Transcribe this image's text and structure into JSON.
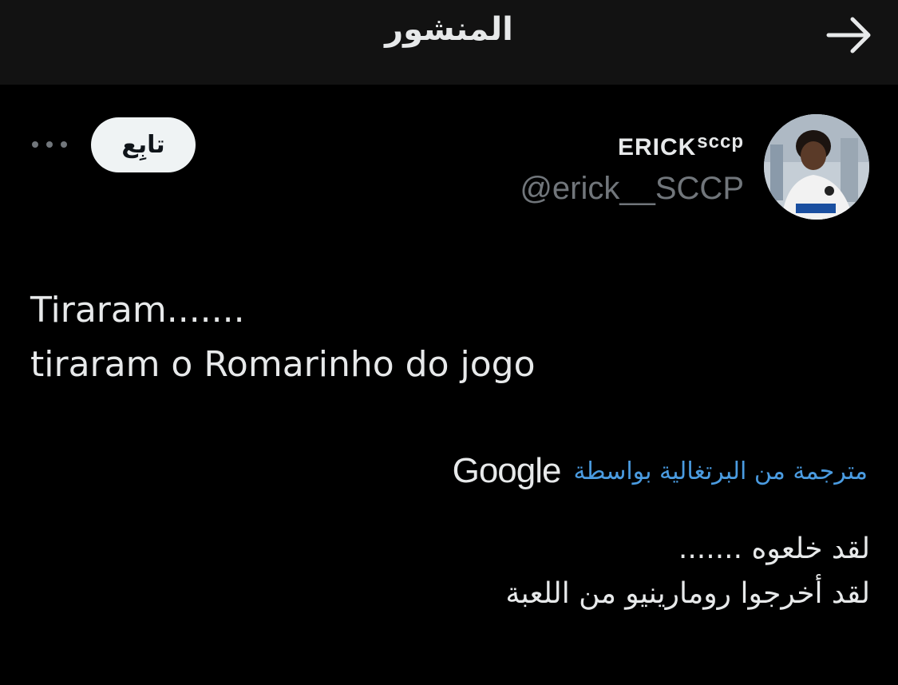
{
  "header": {
    "title": "المنشور",
    "back_icon": "arrow-right-icon"
  },
  "post": {
    "author": {
      "name": "ERICK",
      "name_suffix": "sccp",
      "handle": "@erick__SCCP",
      "avatar": "profile-photo"
    },
    "follow_label": "تابِع",
    "more_icon": "more-horizontal-icon",
    "text": "Tiraram.......\ntiraram o Romarinho do jogo",
    "translation": {
      "label": "مترجمة من البرتغالية بواسطة",
      "provider": "Google",
      "text": "لقد خلعوه .......\nلقد أخرجوا رومارينيو من اللعبة"
    }
  },
  "colors": {
    "background": "#000000",
    "header_background": "#121212",
    "accent_link": "#4a9be0",
    "secondary_text": "#71767b",
    "follow_button": "#eff3f4"
  }
}
